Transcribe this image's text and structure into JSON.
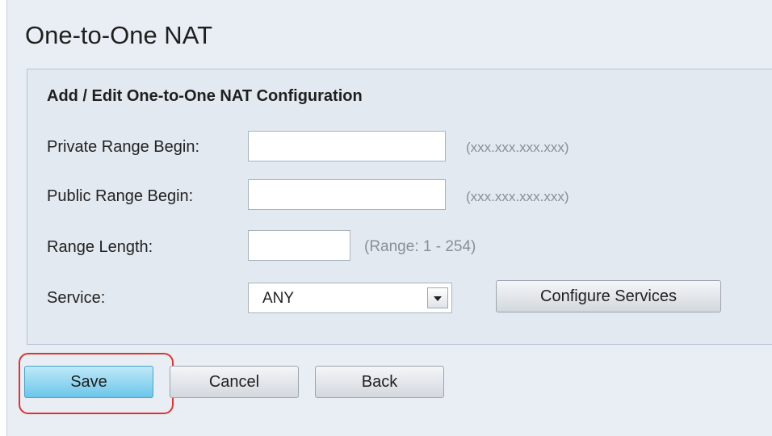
{
  "page": {
    "title": "One-to-One NAT"
  },
  "section": {
    "title": "Add / Edit One-to-One NAT Configuration"
  },
  "fields": {
    "private_range_begin": {
      "label": "Private Range Begin:",
      "value": "",
      "hint": "(xxx.xxx.xxx.xxx)"
    },
    "public_range_begin": {
      "label": "Public Range Begin:",
      "value": "",
      "hint": "(xxx.xxx.xxx.xxx)"
    },
    "range_length": {
      "label": "Range Length:",
      "value": "",
      "hint": "(Range: 1 - 254)"
    },
    "service": {
      "label": "Service:",
      "selected": "ANY"
    }
  },
  "buttons": {
    "configure_services": "Configure Services",
    "save": "Save",
    "cancel": "Cancel",
    "back": "Back"
  },
  "colors": {
    "save_button": "#6cc6ea",
    "highlight": "#e0332f"
  }
}
